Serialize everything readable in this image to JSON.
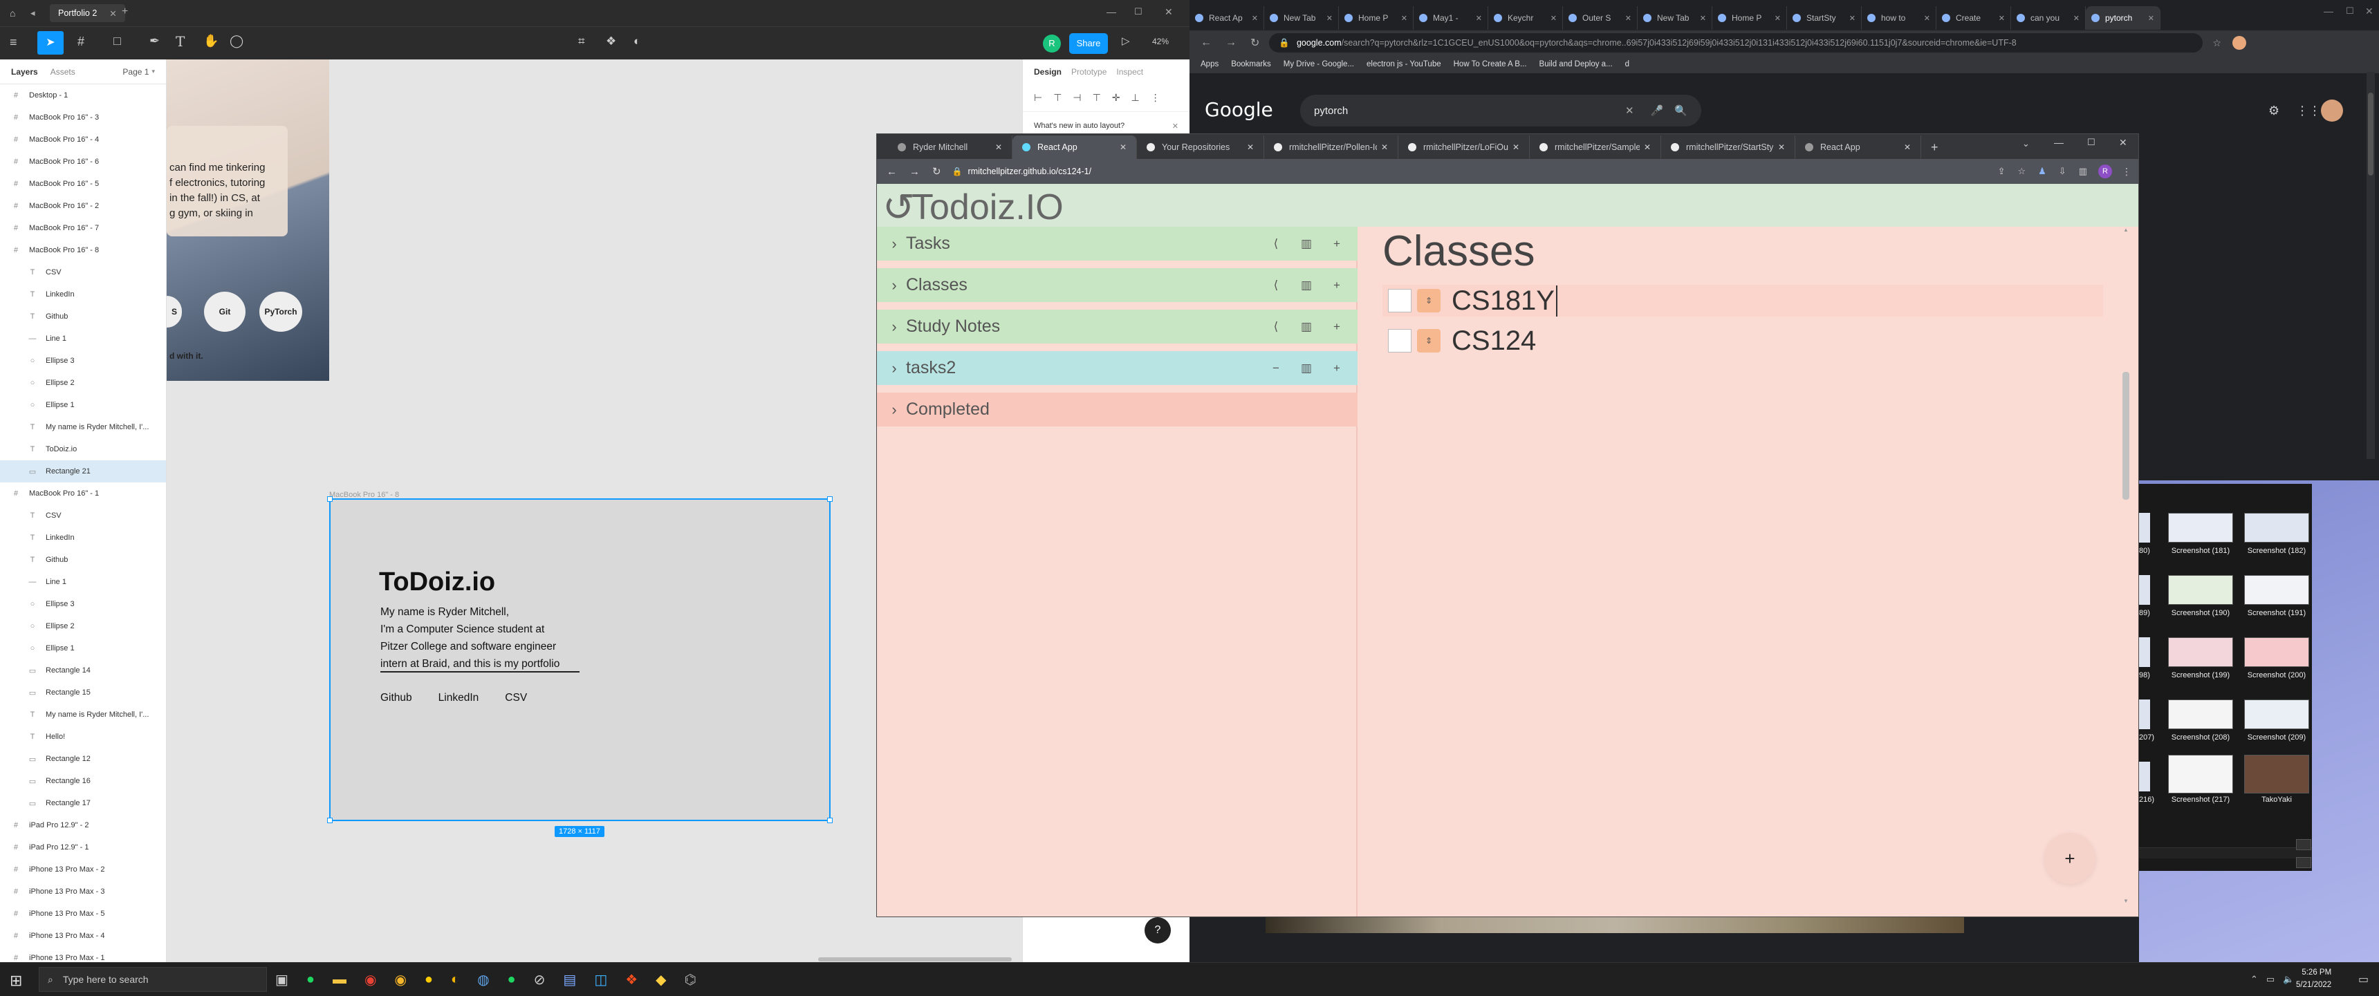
{
  "figma": {
    "file_name": "Portfolio 2",
    "share_label": "Share",
    "zoom": "42%",
    "avatar_initial": "R",
    "tabs": {
      "layers": "Layers",
      "assets": "Assets",
      "page": "Page 1"
    },
    "layers": [
      {
        "label": "Desktop - 1",
        "type": "frame",
        "indent": 0
      },
      {
        "label": "MacBook Pro 16\" - 3",
        "type": "frame",
        "indent": 0
      },
      {
        "label": "MacBook Pro 16\" - 4",
        "type": "frame",
        "indent": 0
      },
      {
        "label": "MacBook Pro 16\" - 6",
        "type": "frame",
        "indent": 0
      },
      {
        "label": "MacBook Pro 16\" - 5",
        "type": "frame",
        "indent": 0
      },
      {
        "label": "MacBook Pro 16\" - 2",
        "type": "frame",
        "indent": 0
      },
      {
        "label": "MacBook Pro 16\" - 7",
        "type": "frame",
        "indent": 0
      },
      {
        "label": "MacBook Pro 16\" - 8",
        "type": "frame",
        "indent": 0
      },
      {
        "label": "CSV",
        "type": "text",
        "indent": 1
      },
      {
        "label": "LinkedIn",
        "type": "text",
        "indent": 1
      },
      {
        "label": "Github",
        "type": "text",
        "indent": 1
      },
      {
        "label": "Line 1",
        "type": "line",
        "indent": 1
      },
      {
        "label": "Ellipse 3",
        "type": "ellipse",
        "indent": 1
      },
      {
        "label": "Ellipse 2",
        "type": "ellipse",
        "indent": 1
      },
      {
        "label": "Ellipse 1",
        "type": "ellipse",
        "indent": 1
      },
      {
        "label": "My name is Ryder Mitchell, I'...",
        "type": "text",
        "indent": 1
      },
      {
        "label": "ToDoiz.io",
        "type": "text",
        "indent": 1
      },
      {
        "label": "Rectangle 21",
        "type": "rect",
        "indent": 1,
        "selected": true
      },
      {
        "label": "MacBook Pro 16\" - 1",
        "type": "frame",
        "indent": 0
      },
      {
        "label": "CSV",
        "type": "text",
        "indent": 1
      },
      {
        "label": "LinkedIn",
        "type": "text",
        "indent": 1
      },
      {
        "label": "Github",
        "type": "text",
        "indent": 1
      },
      {
        "label": "Line 1",
        "type": "line",
        "indent": 1
      },
      {
        "label": "Ellipse 3",
        "type": "ellipse",
        "indent": 1
      },
      {
        "label": "Ellipse 2",
        "type": "ellipse",
        "indent": 1
      },
      {
        "label": "Ellipse 1",
        "type": "ellipse",
        "indent": 1
      },
      {
        "label": "Rectangle 14",
        "type": "rect",
        "indent": 1
      },
      {
        "label": "Rectangle 15",
        "type": "rect",
        "indent": 1
      },
      {
        "label": "My name is Ryder Mitchell, I'...",
        "type": "text",
        "indent": 1
      },
      {
        "label": "Hello!",
        "type": "text",
        "indent": 1
      },
      {
        "label": "Rectangle 12",
        "type": "rect",
        "indent": 1
      },
      {
        "label": "Rectangle 16",
        "type": "rect",
        "indent": 1
      },
      {
        "label": "Rectangle 17",
        "type": "rect",
        "indent": 1
      },
      {
        "label": "iPad Pro 12.9\" - 2",
        "type": "frame",
        "indent": 0
      },
      {
        "label": "iPad Pro 12.9\" - 1",
        "type": "frame",
        "indent": 0
      },
      {
        "label": "iPhone 13 Pro Max - 2",
        "type": "frame",
        "indent": 0
      },
      {
        "label": "iPhone 13 Pro Max - 3",
        "type": "frame",
        "indent": 0
      },
      {
        "label": "iPhone 13 Pro Max - 5",
        "type": "frame",
        "indent": 0
      },
      {
        "label": "iPhone 13 Pro Max - 4",
        "type": "frame",
        "indent": 0
      },
      {
        "label": "iPhone 13 Pro Max - 1",
        "type": "frame",
        "indent": 0
      }
    ],
    "right_tabs": {
      "design": "Design",
      "prototype": "Prototype",
      "inspect": "Inspect"
    },
    "whats_new": "What's new in auto layout?",
    "canvas": {
      "upper_text": [
        "can find me tinkering",
        "f electronics, tutoring",
        "in the fall!) in CS, at",
        "g gym, or skiing in"
      ],
      "chips": [
        "S",
        "Git",
        "PyTorch"
      ],
      "upper_caption": "d with it.",
      "frame_label": "MacBook Pro 16\" - 8",
      "frame_title": "ToDoiz.io",
      "frame_text": [
        "My name is Ryder Mitchell,",
        "I'm a Computer Science student at",
        "Pitzer College and software engineer",
        "intern at Braid, and this is my portfolio"
      ],
      "frame_links": [
        "Github",
        "LinkedIn",
        "CSV"
      ],
      "size_badge": "1728 × 1117",
      "help": "?"
    }
  },
  "chrome_back": {
    "tabs": [
      "React Ap",
      "New Tab",
      "Home P",
      "May1 -",
      "Keychr",
      "Outer S",
      "New Tab",
      "Home P",
      "StartSty",
      "how to",
      "Create",
      "can you",
      "pytorch"
    ],
    "url_host": "google.com",
    "url_rest": "/search?q=pytorch&rlz=1C1GCEU_enUS1000&oq=pytorch&aqs=chrome..69i57j0i433i512j69i59j0i433i512j0i131i433i512j0i433i512j69i60.1151j0j7&sourceid=chrome&ie=UTF-8",
    "bookmarks": [
      "Apps",
      "Bookmarks",
      "My Drive - Google...",
      "electron js - YouTube",
      "How To Create A B...",
      "Build and Deploy a...",
      "d"
    ],
    "search_query": "pytorch",
    "google": "Google"
  },
  "chrome_front": {
    "tabs": [
      {
        "label": "Ryder Mitchell",
        "active": false
      },
      {
        "label": "React App",
        "active": true
      },
      {
        "label": "Your Repositories",
        "active": false
      },
      {
        "label": "rmitchellPitzer/Pollen-Id",
        "active": false
      },
      {
        "label": "rmitchellPitzer/LoFiOut",
        "active": false
      },
      {
        "label": "rmitchellPitzer/SampleI",
        "active": false
      },
      {
        "label": "rmitchellPitzer/StartSty",
        "active": false
      },
      {
        "label": "React App",
        "active": false
      }
    ],
    "url": "rmitchellpitzer.github.io/cs124-1/"
  },
  "todoiz": {
    "title": "Todoiz.IO",
    "sections": [
      {
        "label": "Tasks",
        "color": "#c9e6c4",
        "actions": [
          "share",
          "chart",
          "plus"
        ]
      },
      {
        "label": "Classes",
        "color": "#c9e6c4",
        "actions": [
          "share",
          "chart",
          "plus"
        ]
      },
      {
        "label": "Study Notes",
        "color": "#c9e6c4",
        "actions": [
          "share",
          "chart",
          "plus"
        ]
      },
      {
        "label": "tasks2",
        "color": "#b9e4e4",
        "actions": [
          "minus",
          "chart",
          "plus"
        ]
      },
      {
        "label": "Completed",
        "color": "#f9c7bc",
        "actions": []
      }
    ],
    "main_title": "Classes",
    "items": [
      {
        "label": "CS181Y",
        "editing": true
      },
      {
        "label": "CS124",
        "editing": false
      }
    ],
    "fab": "+"
  },
  "explorer": {
    "thumbs": [
      {
        "label": "Screenshot (181)"
      },
      {
        "label": "Screenshot (182)"
      },
      {
        "label": "Screenshot (190)"
      },
      {
        "label": "Screenshot (191)"
      },
      {
        "label": "Screenshot (199)"
      },
      {
        "label": "Screenshot (200)"
      },
      {
        "label": "Screenshot (208)"
      },
      {
        "label": "Screenshot (209)"
      },
      {
        "label": "Screenshot (217)"
      },
      {
        "label": "TakoYaki"
      }
    ],
    "left_labels": [
      "80)",
      "89)",
      "98)",
      "207)",
      "216)"
    ]
  },
  "taskbar": {
    "search_placeholder": "Type here to search",
    "time": "5:26 PM",
    "date": "5/21/2022"
  },
  "colors": {
    "figma_blue": "#0d99ff",
    "todo_header": "#d7e8d7",
    "todo_bg": "#fbdcd5",
    "item_row": "#fbd5cc",
    "stepper": "#f8b88f",
    "chrome_dark": "#202124"
  }
}
